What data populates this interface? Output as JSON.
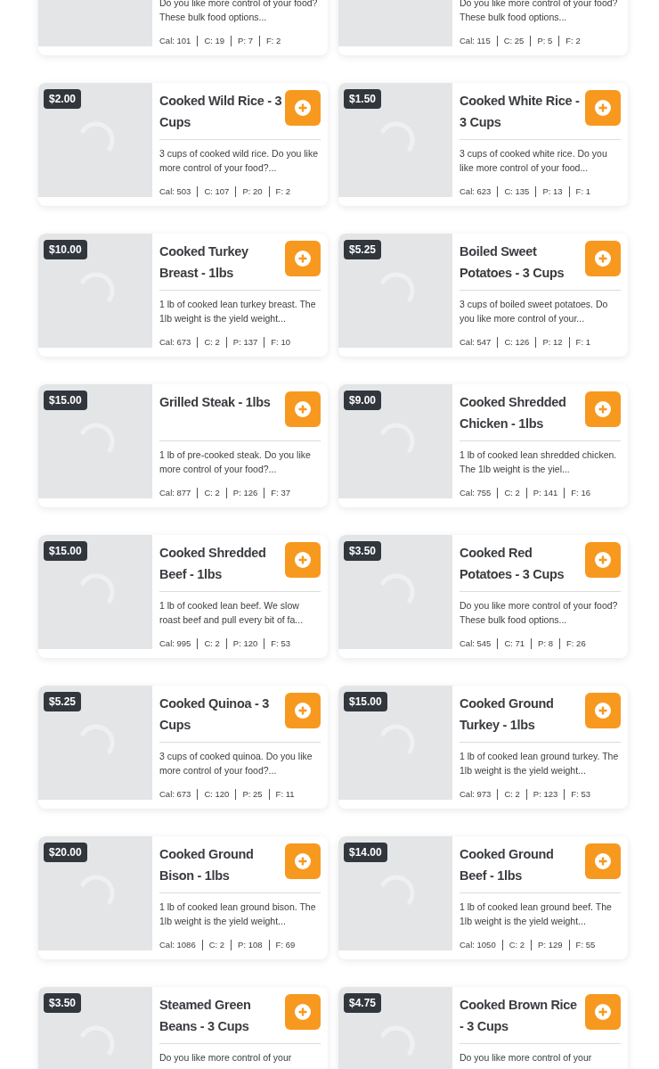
{
  "products": [
    {
      "description": "Do you like more control of your food? These bulk food options...",
      "macros": [
        "Cal: 101",
        "C: 19",
        "P: 7",
        "F: 2"
      ]
    },
    {
      "description": "Do you like more control of your food? These bulk food options...",
      "macros": [
        "Cal: 115",
        "C: 25",
        "P: 5",
        "F: 2"
      ]
    },
    {
      "price": "$2.00",
      "title": "Cooked Wild Rice - 3 Cups",
      "description": "3 cups of cooked wild rice. Do you like more control of your food?...",
      "macros": [
        "Cal: 503",
        "C: 107",
        "P: 20",
        "F: 2"
      ]
    },
    {
      "price": "$1.50",
      "title": "Cooked White Rice - 3 Cups",
      "description": "3 cups of cooked white rice. Do you like more control of your food...",
      "macros": [
        "Cal: 623",
        "C: 135",
        "P: 13",
        "F: 1"
      ]
    },
    {
      "price": "$10.00",
      "title": "Cooked Turkey Breast - 1lbs",
      "description": "1 lb of cooked lean turkey breast. The 1lb weight is the yield weight...",
      "macros": [
        "Cal: 673",
        "C: 2",
        "P: 137",
        "F: 10"
      ]
    },
    {
      "price": "$5.25",
      "title": "Boiled Sweet Potatoes - 3 Cups",
      "description": "3 cups of boiled sweet potatoes. Do you like more control of your...",
      "macros": [
        "Cal: 547",
        "C: 126",
        "P: 12",
        "F: 1"
      ]
    },
    {
      "price": "$15.00",
      "title": "Grilled Steak - 1lbs",
      "description": "1 lb of pre-cooked steak. Do you like more control of your food?...",
      "macros": [
        "Cal: 877",
        "C: 2",
        "P: 126",
        "F: 37"
      ]
    },
    {
      "price": "$9.00",
      "title": "Cooked Shredded Chicken - 1lbs",
      "description": "1 lb of cooked lean shredded chicken. The 1lb weight is the yiel...",
      "macros": [
        "Cal: 755",
        "C: 2",
        "P: 141",
        "F: 16"
      ]
    },
    {
      "price": "$15.00",
      "title": "Cooked Shredded Beef - 1lbs",
      "description": "1 lb of cooked lean beef. We slow roast beef and pull every bit of fa...",
      "macros": [
        "Cal: 995",
        "C: 2",
        "P: 120",
        "F: 53"
      ]
    },
    {
      "price": "$3.50",
      "title": "Cooked Red Potatoes - 3 Cups",
      "description": "Do you like more control of your food? These bulk food options...",
      "macros": [
        "Cal: 545",
        "C: 71",
        "P: 8",
        "F: 26"
      ]
    },
    {
      "price": "$5.25",
      "title": "Cooked Quinoa - 3 Cups",
      "description": "3 cups of cooked quinoa. Do you like more control of your food?...",
      "macros": [
        "Cal: 673",
        "C: 120",
        "P: 25",
        "F: 11"
      ]
    },
    {
      "price": "$15.00",
      "title": "Cooked Ground Turkey - 1lbs",
      "description": "1 lb of cooked lean ground turkey. The 1lb weight is the yield weight...",
      "macros": [
        "Cal: 973",
        "C: 2",
        "P: 123",
        "F: 53"
      ]
    },
    {
      "price": "$20.00",
      "title": "Cooked Ground Bison - 1lbs",
      "description": "1 lb of cooked lean ground bison. The 1lb weight is the yield weight...",
      "macros": [
        "Cal: 1086",
        "C: 2",
        "P: 108",
        "F: 69"
      ]
    },
    {
      "price": "$14.00",
      "title": "Cooked Ground Beef - 1lbs",
      "description": "1 lb of cooked lean ground beef. The 1lb weight is the yield weight...",
      "macros": [
        "Cal: 1050",
        "C: 2",
        "P: 129",
        "F: 55"
      ]
    },
    {
      "price": "$3.50",
      "title": "Steamed Green Beans - 3 Cups",
      "description": "Do you like more control of your"
    },
    {
      "price": "$4.75",
      "title": "Cooked Brown Rice - 3 Cups",
      "description": "Do you like more control of your"
    }
  ]
}
